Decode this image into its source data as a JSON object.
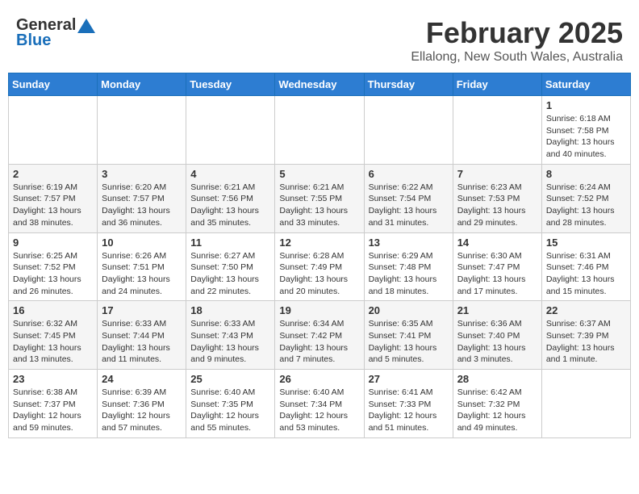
{
  "header": {
    "logo_general": "General",
    "logo_blue": "Blue",
    "month": "February 2025",
    "location": "Ellalong, New South Wales, Australia"
  },
  "weekdays": [
    "Sunday",
    "Monday",
    "Tuesday",
    "Wednesday",
    "Thursday",
    "Friday",
    "Saturday"
  ],
  "weeks": [
    [
      {
        "day": "",
        "info": ""
      },
      {
        "day": "",
        "info": ""
      },
      {
        "day": "",
        "info": ""
      },
      {
        "day": "",
        "info": ""
      },
      {
        "day": "",
        "info": ""
      },
      {
        "day": "",
        "info": ""
      },
      {
        "day": "1",
        "info": "Sunrise: 6:18 AM\nSunset: 7:58 PM\nDaylight: 13 hours and 40 minutes."
      }
    ],
    [
      {
        "day": "2",
        "info": "Sunrise: 6:19 AM\nSunset: 7:57 PM\nDaylight: 13 hours and 38 minutes."
      },
      {
        "day": "3",
        "info": "Sunrise: 6:20 AM\nSunset: 7:57 PM\nDaylight: 13 hours and 36 minutes."
      },
      {
        "day": "4",
        "info": "Sunrise: 6:21 AM\nSunset: 7:56 PM\nDaylight: 13 hours and 35 minutes."
      },
      {
        "day": "5",
        "info": "Sunrise: 6:21 AM\nSunset: 7:55 PM\nDaylight: 13 hours and 33 minutes."
      },
      {
        "day": "6",
        "info": "Sunrise: 6:22 AM\nSunset: 7:54 PM\nDaylight: 13 hours and 31 minutes."
      },
      {
        "day": "7",
        "info": "Sunrise: 6:23 AM\nSunset: 7:53 PM\nDaylight: 13 hours and 29 minutes."
      },
      {
        "day": "8",
        "info": "Sunrise: 6:24 AM\nSunset: 7:52 PM\nDaylight: 13 hours and 28 minutes."
      }
    ],
    [
      {
        "day": "9",
        "info": "Sunrise: 6:25 AM\nSunset: 7:52 PM\nDaylight: 13 hours and 26 minutes."
      },
      {
        "day": "10",
        "info": "Sunrise: 6:26 AM\nSunset: 7:51 PM\nDaylight: 13 hours and 24 minutes."
      },
      {
        "day": "11",
        "info": "Sunrise: 6:27 AM\nSunset: 7:50 PM\nDaylight: 13 hours and 22 minutes."
      },
      {
        "day": "12",
        "info": "Sunrise: 6:28 AM\nSunset: 7:49 PM\nDaylight: 13 hours and 20 minutes."
      },
      {
        "day": "13",
        "info": "Sunrise: 6:29 AM\nSunset: 7:48 PM\nDaylight: 13 hours and 18 minutes."
      },
      {
        "day": "14",
        "info": "Sunrise: 6:30 AM\nSunset: 7:47 PM\nDaylight: 13 hours and 17 minutes."
      },
      {
        "day": "15",
        "info": "Sunrise: 6:31 AM\nSunset: 7:46 PM\nDaylight: 13 hours and 15 minutes."
      }
    ],
    [
      {
        "day": "16",
        "info": "Sunrise: 6:32 AM\nSunset: 7:45 PM\nDaylight: 13 hours and 13 minutes."
      },
      {
        "day": "17",
        "info": "Sunrise: 6:33 AM\nSunset: 7:44 PM\nDaylight: 13 hours and 11 minutes."
      },
      {
        "day": "18",
        "info": "Sunrise: 6:33 AM\nSunset: 7:43 PM\nDaylight: 13 hours and 9 minutes."
      },
      {
        "day": "19",
        "info": "Sunrise: 6:34 AM\nSunset: 7:42 PM\nDaylight: 13 hours and 7 minutes."
      },
      {
        "day": "20",
        "info": "Sunrise: 6:35 AM\nSunset: 7:41 PM\nDaylight: 13 hours and 5 minutes."
      },
      {
        "day": "21",
        "info": "Sunrise: 6:36 AM\nSunset: 7:40 PM\nDaylight: 13 hours and 3 minutes."
      },
      {
        "day": "22",
        "info": "Sunrise: 6:37 AM\nSunset: 7:39 PM\nDaylight: 13 hours and 1 minute."
      }
    ],
    [
      {
        "day": "23",
        "info": "Sunrise: 6:38 AM\nSunset: 7:37 PM\nDaylight: 12 hours and 59 minutes."
      },
      {
        "day": "24",
        "info": "Sunrise: 6:39 AM\nSunset: 7:36 PM\nDaylight: 12 hours and 57 minutes."
      },
      {
        "day": "25",
        "info": "Sunrise: 6:40 AM\nSunset: 7:35 PM\nDaylight: 12 hours and 55 minutes."
      },
      {
        "day": "26",
        "info": "Sunrise: 6:40 AM\nSunset: 7:34 PM\nDaylight: 12 hours and 53 minutes."
      },
      {
        "day": "27",
        "info": "Sunrise: 6:41 AM\nSunset: 7:33 PM\nDaylight: 12 hours and 51 minutes."
      },
      {
        "day": "28",
        "info": "Sunrise: 6:42 AM\nSunset: 7:32 PM\nDaylight: 12 hours and 49 minutes."
      },
      {
        "day": "",
        "info": ""
      }
    ]
  ]
}
